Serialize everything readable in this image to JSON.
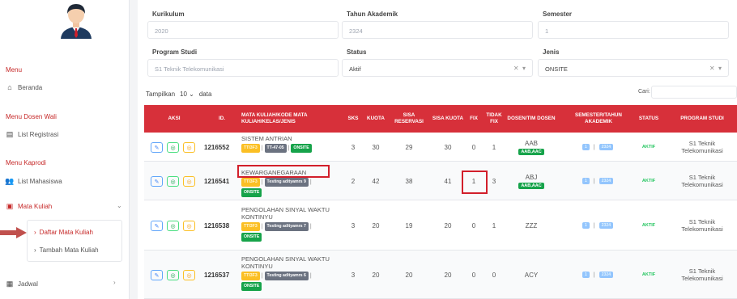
{
  "sidebar": {
    "sections": [
      {
        "heading": "Menu",
        "items": [
          {
            "label": "Beranda"
          }
        ]
      },
      {
        "heading": "Menu Dosen Wali",
        "items": [
          {
            "label": "List Registrasi"
          }
        ]
      },
      {
        "heading": "Menu Kaprodi",
        "items": [
          {
            "label": "List Mahasiswa"
          },
          {
            "label": "Mata Kuliah"
          }
        ]
      }
    ],
    "submenu": [
      {
        "label": "Daftar Mata Kuliah"
      },
      {
        "label": "Tambah Mata Kuliah"
      }
    ],
    "jadwal": "Jadwal",
    "accent": "#c62828"
  },
  "filters": {
    "kurikulum": {
      "label": "Kurikulum",
      "value": "2020"
    },
    "tahun": {
      "label": "Tahun Akademik",
      "value": "2324"
    },
    "semester": {
      "label": "Semester",
      "value": "1"
    },
    "prodi": {
      "label": "Program Studi",
      "value": "S1 Teknik Telekomunikasi"
    },
    "status": {
      "label": "Status",
      "value": "Aktif"
    },
    "jenis": {
      "label": "Jenis",
      "value": "ONSITE"
    }
  },
  "table_controls": {
    "show_prefix": "Tampilkan",
    "page_size": "10",
    "show_suffix": "data",
    "search_label": "Cari:"
  },
  "table": {
    "header_color": "#d7303a",
    "columns": [
      "AKSI",
      "ID.",
      "MATA KULIAH/KODE MATA KULIAH/KELAS/JENIS",
      "SKS",
      "KUOTA",
      "SISA RESERVASI",
      "SISA KUOTA",
      "FIX",
      "TIDAK FIX",
      "DOSEN/TIM DOSEN",
      "SEMESTER/TAHUN AKADEMIK",
      "STATUS",
      "PROGRAM STUDI"
    ],
    "rows": [
      {
        "id": "1216552",
        "line1": "SISTEM ANTRIAN",
        "line2": "",
        "code": "TTI3F3",
        "class": "TT-47-05",
        "jenis": "ONSITE",
        "sks": "3",
        "kuota": "30",
        "sisa_reservasi": "29",
        "sisa_kuota": "30",
        "fix": "0",
        "tidak_fix": "1",
        "dosen": "AAB",
        "tim": "AAB,AAC",
        "semester": "1",
        "tahun": "2324",
        "status": "AKTIF",
        "prodi_1": "S1 Teknik",
        "prodi_2": "Telekomunikasi"
      },
      {
        "id": "1216541",
        "line1": "KEWARGANEGARAAN",
        "line2": "",
        "code": "TTI3F3",
        "class": "Testing adityamrs 9",
        "jenis": "ONSITE",
        "sks": "2",
        "kuota": "42",
        "sisa_reservasi": "38",
        "sisa_kuota": "41",
        "fix": "1",
        "tidak_fix": "3",
        "dosen": "ABJ",
        "tim": "AAB,AAC",
        "semester": "1",
        "tahun": "2324",
        "status": "AKTIF",
        "prodi_1": "S1 Teknik",
        "prodi_2": "Telekomunikasi"
      },
      {
        "id": "1216538",
        "line1": "PENGOLAHAN SINYAL WAKTU",
        "line2": "KONTINYU",
        "code": "TTI3F3",
        "class": "Testing adityamrs 7",
        "jenis": "ONSITE",
        "sks": "3",
        "kuota": "20",
        "sisa_reservasi": "19",
        "sisa_kuota": "20",
        "fix": "0",
        "tidak_fix": "1",
        "dosen": "ZZZ",
        "tim": "",
        "semester": "1",
        "tahun": "2324",
        "status": "AKTIF",
        "prodi_1": "S1 Teknik",
        "prodi_2": "Telekomunikasi"
      },
      {
        "id": "1216537",
        "line1": "PENGOLAHAN SINYAL WAKTU",
        "line2": "KONTINYU",
        "code": "TTI3F3",
        "class": "Testing adityamrs 6",
        "jenis": "ONSITE",
        "sks": "3",
        "kuota": "20",
        "sisa_reservasi": "20",
        "sisa_kuota": "20",
        "fix": "0",
        "tidak_fix": "0",
        "dosen": "ACY",
        "tim": "",
        "semester": "1",
        "tahun": "2324",
        "status": "AKTIF",
        "prodi_1": "S1 Teknik",
        "prodi_2": "Telekomunikasi"
      }
    ]
  }
}
